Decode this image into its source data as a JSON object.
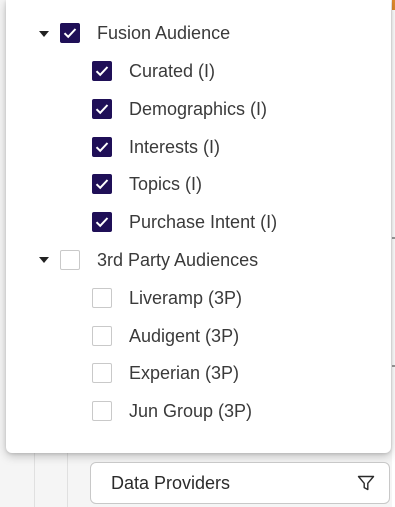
{
  "tree": {
    "groups": [
      {
        "label": "Fusion Audience",
        "checked": true,
        "expanded": true,
        "children": [
          {
            "label": "Curated (I)",
            "checked": true
          },
          {
            "label": "Demographics (I)",
            "checked": true
          },
          {
            "label": "Interests (I)",
            "checked": true
          },
          {
            "label": "Topics (I)",
            "checked": true
          },
          {
            "label": "Purchase Intent (I)",
            "checked": true
          }
        ]
      },
      {
        "label": "3rd Party Audiences",
        "checked": false,
        "expanded": true,
        "children": [
          {
            "label": "Liveramp (3P)",
            "checked": false
          },
          {
            "label": "Audigent (3P)",
            "checked": false
          },
          {
            "label": "Experian (3P)",
            "checked": false
          },
          {
            "label": "Jun Group (3P)",
            "checked": false
          }
        ]
      }
    ]
  },
  "filter": {
    "label": "Data Providers",
    "icon": "filter-icon"
  },
  "colors": {
    "checkbox_checked": "#1f0f57",
    "checkbox_border": "#c9c9c9"
  }
}
